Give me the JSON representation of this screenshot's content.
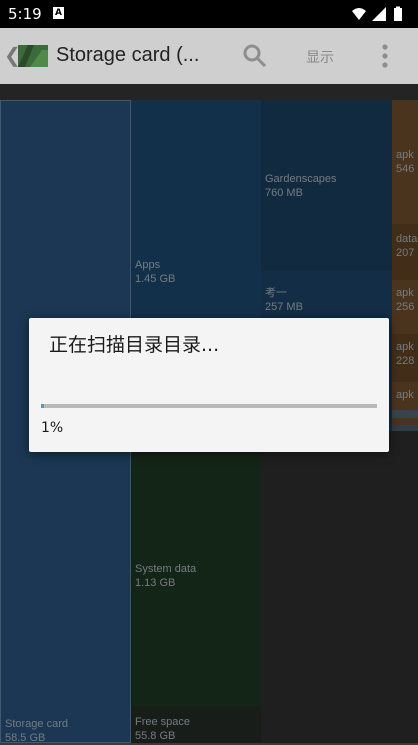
{
  "status_bar": {
    "time": "5:19",
    "notification_letter": "A"
  },
  "app_bar": {
    "back_glyph": "❮",
    "title": "Storage card (...",
    "show_label": "显示",
    "search_icon": "search-icon",
    "overflow_icon": "more-vert-icon"
  },
  "treemap": {
    "storage_card": {
      "name": "Storage card",
      "size": "58.5 GB"
    },
    "apps": {
      "name": "Apps",
      "size": "1.45 GB"
    },
    "system_data": {
      "name": "System data",
      "size": "1.13 GB"
    },
    "free_space": {
      "name": "Free space",
      "size": "55.8 GB"
    },
    "gardenscapes": {
      "name": "Gardenscapes",
      "size": "760 MB"
    },
    "kaoyi": {
      "name": "考一",
      "size": "257 MB"
    },
    "apk_1": {
      "name": "apk",
      "size": "546"
    },
    "data_1": {
      "name": "data",
      "size": "207"
    },
    "apk_2": {
      "name": "apk",
      "size": "256"
    },
    "apk_3": {
      "name": "apk",
      "size": "228"
    },
    "apk_4": {
      "name": "apk"
    }
  },
  "dialog": {
    "title": "正在扫描目录目录...",
    "progress_text": "1%",
    "progress_fraction": 0.01
  },
  "colors": {
    "storage": "#2c5a86",
    "apps": "#204e7a",
    "gardenscapes": "#1d4468",
    "system_data": "#1f3d26",
    "free_space": "#27302a",
    "apk": "#7a5530",
    "progress": "#3fa0d8"
  }
}
